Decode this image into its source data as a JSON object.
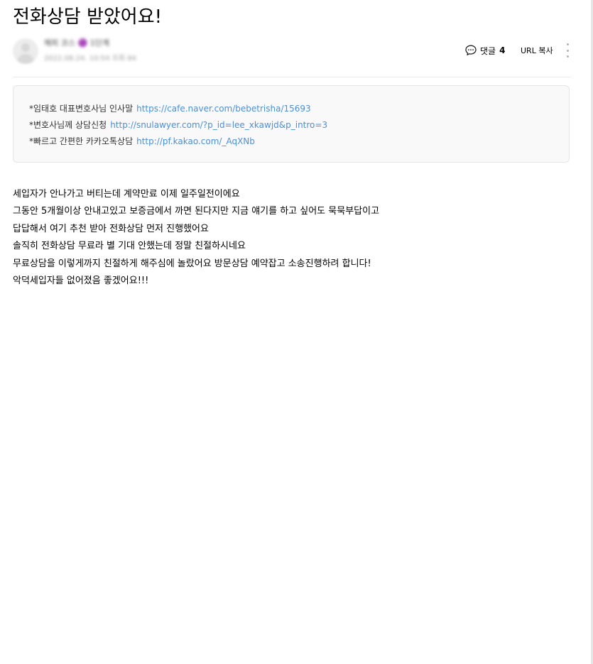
{
  "post": {
    "title": "전화상담 받았어요!",
    "author": {
      "name": "해피 코스 🟣 1단계",
      "date": "2022.08.24. 10:54  조회 84"
    }
  },
  "actions": {
    "comment_label": "댓글",
    "comment_count": "4",
    "url_copy_label": "URL 복사"
  },
  "info_box": {
    "lines": [
      {
        "label": "*임태호 대표변호사님 인사말",
        "url": "https://cafe.naver.com/bebetrisha/15693"
      },
      {
        "label": "*변호사님께 상담신청",
        "url": "http://snulawyer.com/?p_id=lee_xkawjd&p_intro=3"
      },
      {
        "label": "*빠르고 간편한 카카오톡상담",
        "url": "http://pf.kakao.com/_AqXNb"
      }
    ]
  },
  "content": {
    "lines": [
      "세입자가 안나가고 버티는데 계약만료 이제 일주일전이에요",
      "그동안 5개월이상 안내고있고 보증금에서 까면 된다지만 지금 얘기를 하고 싶어도 묵묵부답이고",
      "답답해서 여기 추천 받아 전화상담 먼저 진행했어요",
      "솔직히 전화상담 무료라 별 기대 안했는데 정말 친절하시네요",
      "무료상담을 이렇게까지 친절하게 해주심에 놀랐어요 방문상담 예약잡고 소송진행하려 합니다!",
      "악덕세입자들 없어졌음 좋겠어요!!!"
    ]
  },
  "icons": {
    "comment": "speech-bubble-icon",
    "more": "vertical-ellipsis-icon",
    "avatar": "default-profile-icon"
  },
  "colors": {
    "link": "#4b8fd8",
    "info_box_bg": "#f9f9fa",
    "divider": "#ebebeb"
  }
}
